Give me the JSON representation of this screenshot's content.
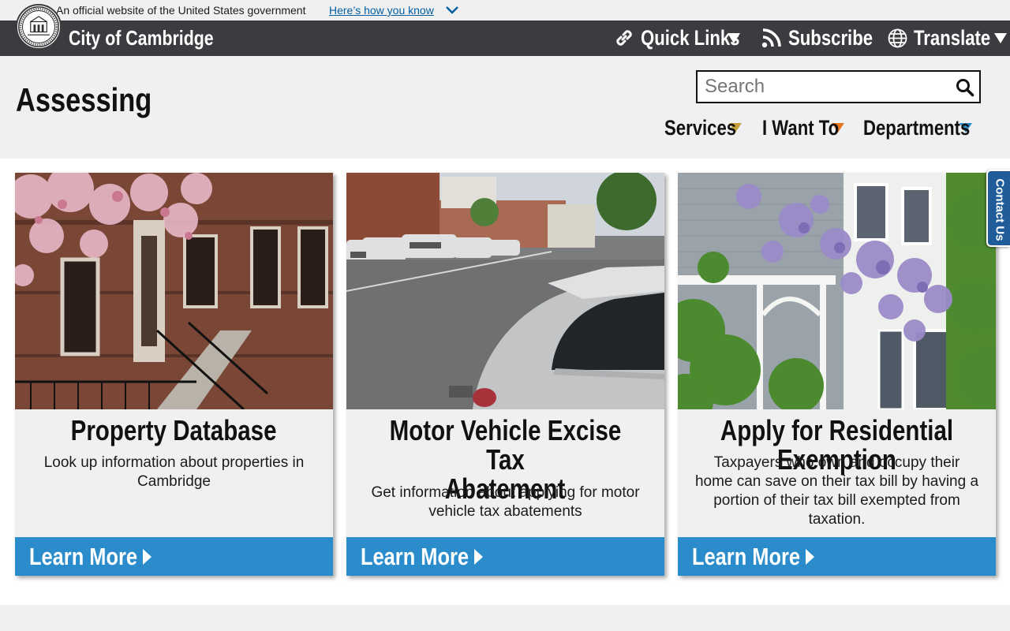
{
  "gov_banner": {
    "text": "An official website of the United States government",
    "link": "Here’s how you know"
  },
  "topbar": {
    "site_name": "City of Cambridge",
    "quick_links": "Quick Links",
    "subscribe": "Subscribe",
    "translate": "Translate"
  },
  "header": {
    "page_title": "Assessing",
    "search_placeholder": "Search",
    "nav": [
      {
        "label": "Services",
        "color": "#c8a13a"
      },
      {
        "label": "I Want To",
        "color": "#e87722"
      },
      {
        "label": "Departments",
        "color": "#2b8ccc"
      }
    ]
  },
  "cards": [
    {
      "title": "Property Database",
      "description": "Look up information about properties in Cambridge",
      "button": "Learn More"
    },
    {
      "title_line1": "Motor Vehicle Excise Tax",
      "title_line2": "Abatement",
      "description": "Get information about applying for motor vehicle tax abatements",
      "button": "Learn More"
    },
    {
      "title": "Apply for Residential Exemption",
      "description": "Taxpayers who own and occupy their home can save on their tax bill by having a portion of their tax bill exempted from taxation.",
      "button": "Learn More"
    }
  ],
  "contact_tab": "Contact Us",
  "colors": {
    "topbar": "#3b3c3f",
    "button_blue": "#2b8ccc",
    "contact_blue": "#1f5c99"
  }
}
